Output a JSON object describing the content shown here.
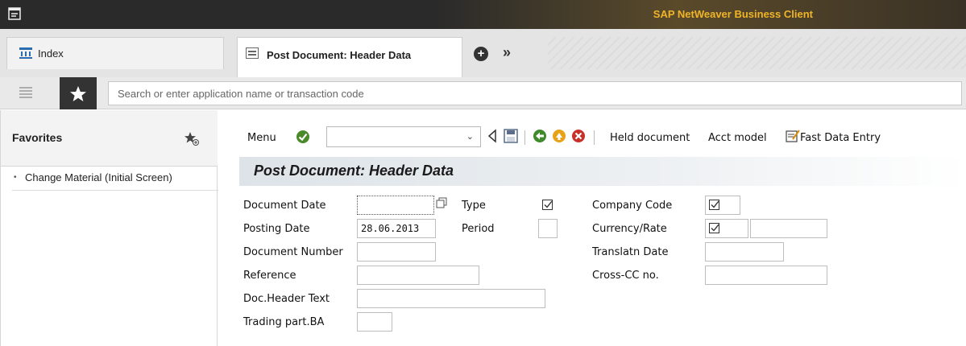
{
  "window": {
    "app_title": "SAP NetWeaver Business Client"
  },
  "tabs": {
    "index_label": "Index",
    "active_label": "Post Document: Header Data"
  },
  "search": {
    "placeholder": "Search or enter application name or transaction code"
  },
  "sidebar": {
    "title": "Favorites",
    "items": [
      {
        "label": "Change Material (Initial Screen)"
      }
    ]
  },
  "toolbar": {
    "menu_label": "Menu",
    "dropdown_value": "",
    "held_document_label": "Held document",
    "acct_model_label": "Acct model",
    "fast_data_entry_label": "Fast Data Entry"
  },
  "page": {
    "title": "Post Document: Header Data"
  },
  "form": {
    "document_date": {
      "label": "Document Date",
      "value": ""
    },
    "posting_date": {
      "label": "Posting Date",
      "value": "28.06.2013"
    },
    "document_number": {
      "label": "Document Number",
      "value": ""
    },
    "reference": {
      "label": "Reference",
      "value": ""
    },
    "doc_header_text": {
      "label": "Doc.Header Text",
      "value": ""
    },
    "trading_part_ba": {
      "label": "Trading part.BA",
      "value": ""
    },
    "type": {
      "label": "Type",
      "value": ""
    },
    "period": {
      "label": "Period",
      "value": ""
    },
    "company_code": {
      "label": "Company Code",
      "value": ""
    },
    "currency_rate": {
      "label": "Currency/Rate",
      "value": "",
      "rate_value": ""
    },
    "translatn_date": {
      "label": "Translatn Date",
      "value": ""
    },
    "cross_cc_no": {
      "label": "Cross-CC no.",
      "value": ""
    }
  },
  "colors": {
    "title_accent": "#f0b429",
    "dark_bar": "#2a2a2a"
  }
}
